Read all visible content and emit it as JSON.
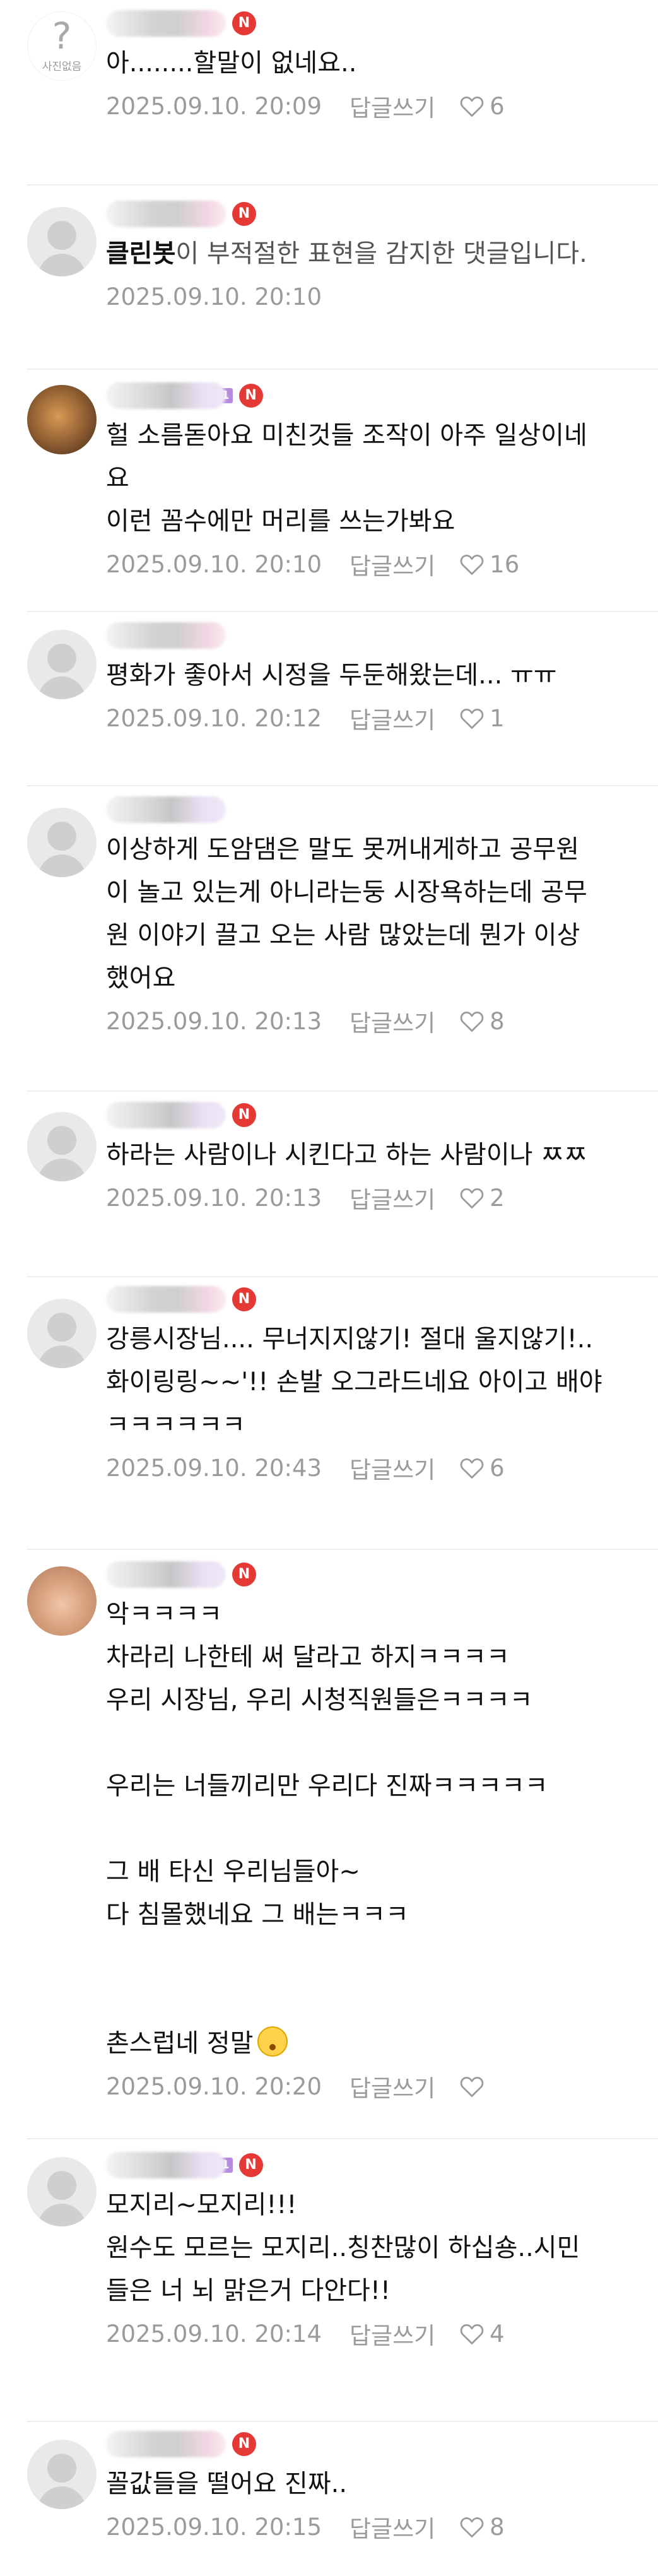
{
  "reply_label": "답글쓰기",
  "comments": [
    {
      "avatar": "no-photo",
      "avatar_text": "사진없음",
      "nick_style": "pink",
      "level": "",
      "badge": "N",
      "lines": [
        "아........할말이 없네요.."
      ],
      "time": "2025.09.10. 20:09",
      "has_reply": true,
      "likes": "6"
    },
    {
      "avatar": "person",
      "nick_style": "pink",
      "level": "",
      "badge": "N",
      "bot_prefix": "클린봇",
      "lines": [
        "이 부적절한 표현을 감지한 댓글입니다."
      ],
      "time": "2025.09.10. 20:10",
      "has_reply": false,
      "likes": ""
    },
    {
      "avatar": "cat",
      "nick_style": "purple",
      "level": "1",
      "badge": "N",
      "lines": [
        "헐 소름돋아요 미친것들 조작이 아주 일상이네",
        "요",
        "이런 꼼수에만 머리를 쓰는가봐요"
      ],
      "time": "2025.09.10. 20:10",
      "has_reply": true,
      "likes": "16"
    },
    {
      "avatar": "person",
      "nick_style": "pink",
      "level": "",
      "badge": "",
      "lines": [
        "평화가 좋아서 시정을 두둔해왔는데... ㅠㅠ"
      ],
      "time": "2025.09.10. 20:12",
      "has_reply": true,
      "likes": "1"
    },
    {
      "avatar": "person",
      "nick_style": "purple",
      "level": "",
      "badge": "",
      "lines": [
        "이상하게 도암댐은 말도 못꺼내게하고 공무원",
        "이 놀고 있는게 아니라는둥 시장욕하는데 공무",
        "원 이야기 끌고 오는 사람 많았는데 뭔가 이상",
        "했어요"
      ],
      "time": "2025.09.10. 20:13",
      "has_reply": true,
      "likes": "8"
    },
    {
      "avatar": "person",
      "nick_style": "purple",
      "level": "",
      "badge": "N",
      "lines": [
        "하라는 사람이나 시킨다고 하는 사람이나 ㅉㅉ"
      ],
      "time": "2025.09.10. 20:13",
      "has_reply": true,
      "likes": "2"
    },
    {
      "avatar": "person",
      "nick_style": "pink",
      "level": "",
      "badge": "N",
      "lines": [
        "강릉시장님.... 무너지지않기! 절대 울지않기!..",
        "화이링링~~'!! 손발 오그라드네요 아이고 배야",
        "ㅋㅋㅋㅋㅋㅋ"
      ],
      "time": "2025.09.10. 20:43",
      "has_reply": true,
      "likes": "6"
    },
    {
      "avatar": "blob",
      "nick_style": "purple",
      "level": "",
      "badge": "N",
      "lines": [
        "악ㅋㅋㅋㅋ",
        "차라리 나한테 써 달라고 하지ㅋㅋㅋㅋ",
        "우리 시장님, 우리 시청직원들은ㅋㅋㅋㅋ",
        "",
        "우리는 너들끼리만 우리다 진짜ㅋㅋㅋㅋㅋ",
        "",
        "그 배 타신 우리님들아~",
        "다 침몰했네요 그 배는ㅋㅋㅋ",
        "",
        "",
        "촌스럽네 정말"
      ],
      "last_line_emoji": "flushed-face-emoji",
      "time": "2025.09.10. 20:20",
      "has_reply": true,
      "likes": ""
    },
    {
      "avatar": "person",
      "nick_style": "purple",
      "level": "1",
      "badge": "N",
      "lines": [
        "모지리~모지리!!!",
        "원수도 모르는 모지리..칭찬많이 하십숑..시민",
        "들은 너 뇌 맑은거 다안다!!"
      ],
      "time": "2025.09.10. 20:14",
      "has_reply": true,
      "likes": "4"
    },
    {
      "avatar": "person",
      "nick_style": "pink",
      "level": "",
      "badge": "N",
      "lines": [
        "꼴값들을 떨어요 진짜.."
      ],
      "time": "2025.09.10. 20:15",
      "has_reply": true,
      "likes": "8"
    }
  ]
}
